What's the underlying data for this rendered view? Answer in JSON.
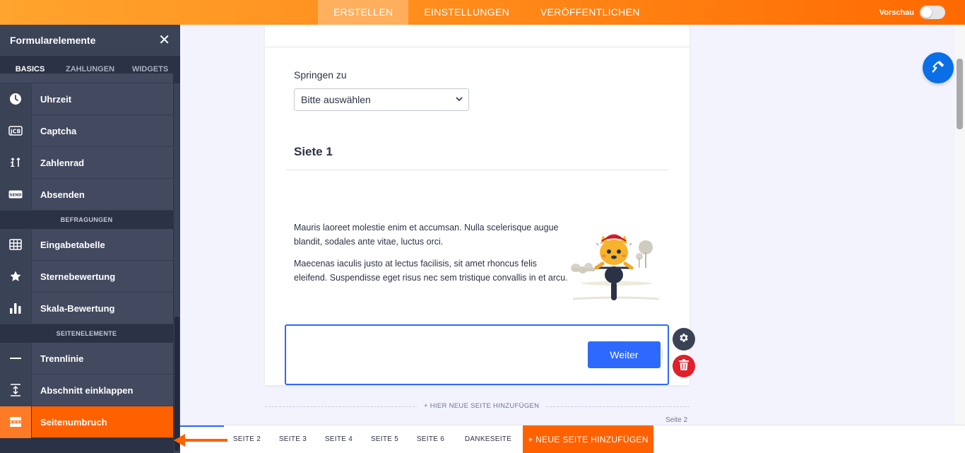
{
  "topbar": {
    "tabs": [
      "ERSTELLEN",
      "EINSTELLUNGEN",
      "VERÖFFENTLICHEN"
    ],
    "active_tab": "ERSTELLEN",
    "preview_label": "Vorschau",
    "preview_on": false
  },
  "leftpanel": {
    "title": "Formularelemente",
    "close_icon": "close-icon",
    "tabs": [
      "BASICS",
      "ZAHLUNGEN",
      "WIDGETS"
    ],
    "items": [
      {
        "label": "Uhrzeit",
        "icon": "clock-icon"
      },
      {
        "label": "Captcha",
        "icon": "captcha-icon"
      },
      {
        "label": "Zahlenrad",
        "icon": "spinner-icon"
      },
      {
        "label": "Absenden",
        "icon": "send-icon"
      },
      {
        "label": "Eingabetabelle",
        "icon": "table-icon"
      },
      {
        "label": "Sternebewertung",
        "icon": "star-icon"
      },
      {
        "label": "Skala-Bewertung",
        "icon": "bar-chart-icon"
      },
      {
        "label": "Trennlinie",
        "icon": "divider-icon"
      },
      {
        "label": "Abschnitt einklappen",
        "icon": "collapse-icon"
      },
      {
        "label": "Seitenumbruch",
        "icon": "page-break-icon"
      }
    ],
    "sections": {
      "surveys": "BEFRAGUNGEN",
      "page_elements": "SEITENELEMENTE"
    }
  },
  "form": {
    "jump_label": "Springen zu",
    "jump_select_value": "Bitte auswählen",
    "page_title": "Siete 1",
    "paragraph1": "Mauris laoreet molestie enim et accumsan. Nulla scelerisque augue blandit, sodales ante vitae, luctus orci.",
    "paragraph2": "Maecenas iaculis justo at lectus facilisis, sit amet rhoncus felis eleifend. Suspendisse eget risus nec sem tristique convallis in et arcu.",
    "next_button": "Weiter",
    "add_page_label": "+ HIER NEUE SEITE HINZUFÜGEN",
    "next_page_label": "Seite 2"
  },
  "pagebar": {
    "pages": [
      "SEITE 2",
      "SEITE 3",
      "SEITE 4",
      "SEITE 5",
      "SEITE 6",
      "DANKESEITE"
    ],
    "add_button": "+ NEUE SEITE HINZUFÜGEN"
  },
  "colors": {
    "accent": "#ff6100",
    "primary": "#2e69ff",
    "panel": "#2b3245",
    "danger": "#e0202a"
  }
}
